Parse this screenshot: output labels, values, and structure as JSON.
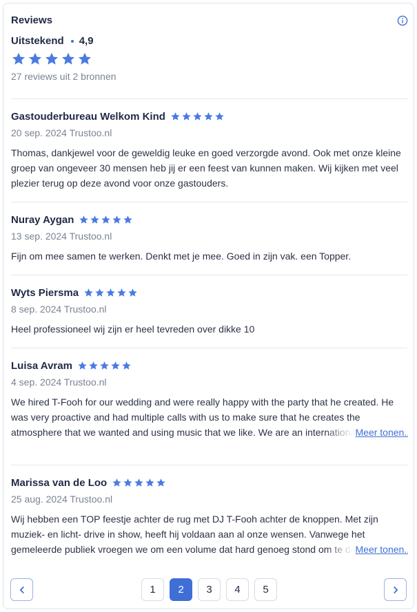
{
  "header": {
    "title": "Reviews",
    "rating_word": "Uitstekend",
    "rating_value": "4,9",
    "summary": "27 reviews uit 2 bronnen"
  },
  "reviews": [
    {
      "name": "Gastouderbureau Welkom Kind",
      "meta": "20 sep. 2024 Trustoo.nl",
      "text": "Thomas, dankjewel voor de geweldig leuke en goed verzorgde avond. Ook met onze kleine groep van ongeveer 30 mensen heb jij er een feest van kunnen maken. Wij kijken met veel plezier terug op deze avond voor onze gastouders.",
      "stars": 5
    },
    {
      "name": "Nuray Aygan",
      "meta": "13 sep. 2024 Trustoo.nl",
      "text": "Fijn om mee samen te werken. Denkt met je mee. Goed in zijn vak. een Topper.",
      "stars": 5
    },
    {
      "name": "Wyts Piersma",
      "meta": "8 sep. 2024 Trustoo.nl",
      "text": "Heel professioneel wij zijn er heel tevreden over dikke 10",
      "stars": 5
    },
    {
      "name": "Luisa Avram",
      "meta": "4 sep. 2024 Trustoo.nl",
      "text": "We hired T-Fooh for our wedding and were really happy with the party that he created. He was very proactive and had multiple calls with us to make sure that he creates the atmosphere that we wanted and using music that we like. We are an international couple so it was not the typical Dutch music that we asked for, but T-fooh delivered",
      "more": "Meer tonen...",
      "stars": 5
    },
    {
      "name": "Marissa van de Loo",
      "meta": "25 aug. 2024 Trustoo.nl",
      "text": "Wij hebben een TOP feestje achter de rug met DJ T-Fooh achter de knoppen. Met zijn muziek- en licht- drive in show, heeft hij voldaan aan al onze wensen. Vanwege het gemeleerde publiek vroegen we om een volume dat hard genoeg stond om te dansen, waarbij je nog altijd verstaanbaar kon kletsen. En dat is gelukt! Thomas is echt",
      "more": "Meer tonen...",
      "stars": 5
    }
  ],
  "pagination": {
    "pages": [
      "1",
      "2",
      "3",
      "4",
      "5"
    ],
    "current": "2"
  },
  "colors": {
    "accent": "#3f6fd6",
    "star": "#4a7be0",
    "text": "#1f2a44",
    "muted": "#7b8294"
  },
  "icons": {
    "info": "info-circle-icon",
    "prev": "chevron-left-icon",
    "next": "chevron-right-icon",
    "star": "star-icon"
  }
}
